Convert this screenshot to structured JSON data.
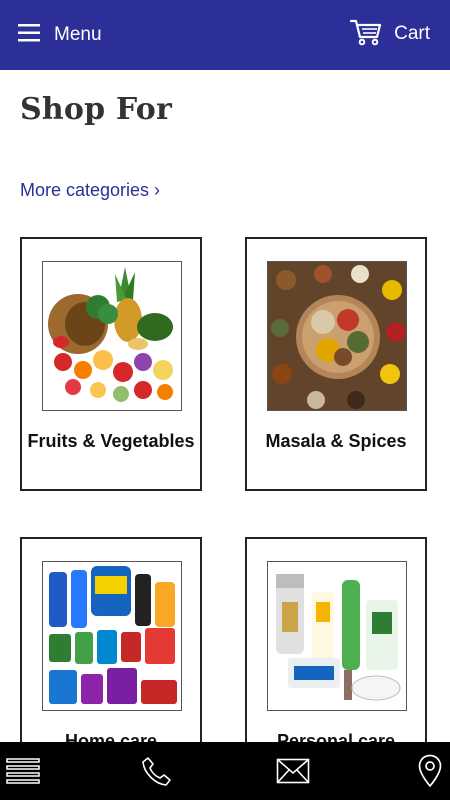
{
  "header": {
    "menu_label": "Menu",
    "cart_label": "Cart",
    "background": "#2b2f97"
  },
  "main": {
    "title": "Shop For",
    "more_categories": "More categories ›",
    "categories": [
      {
        "label": "Fruits & Vegetables",
        "image": "fruits-vegetables-photo"
      },
      {
        "label": "Masala & Spices",
        "image": "masala-spices-photo"
      },
      {
        "label": "Home care",
        "image": "home-care-products-photo"
      },
      {
        "label": "Personal care",
        "image": "personal-care-products-photo"
      }
    ]
  },
  "bottom_bar": {
    "icons": [
      "menu-icon",
      "phone-icon",
      "mail-icon",
      "location-pin-icon"
    ],
    "background": "#000000"
  }
}
